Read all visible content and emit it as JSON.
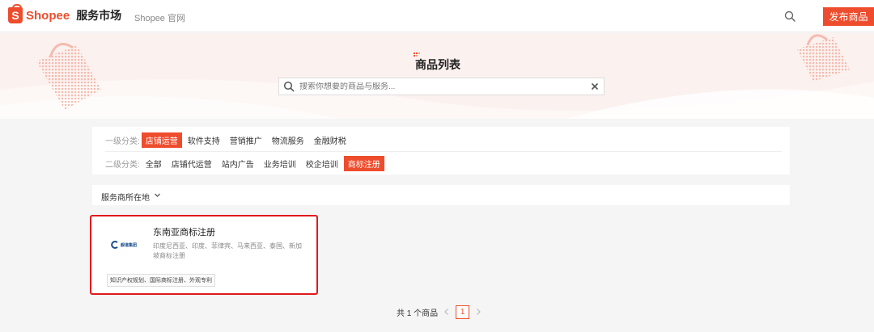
{
  "colors": {
    "brand": "#ee4d2d",
    "highlight_border": "#e0191c"
  },
  "header": {
    "logo_icon": "shopee-bag-icon",
    "logo_glyph": "S",
    "brand": "Shopee",
    "market": "服务市场",
    "official_link": "Shopee 官网",
    "search_icon": "search-icon",
    "publish_button": "发布商品"
  },
  "banner": {
    "title": "商品列表",
    "search_placeholder": "搜索你想要的商品与服务...",
    "search_icon": "search-icon",
    "clear_icon": "close-icon"
  },
  "categories": {
    "level1_label": "一级分类:",
    "level1_items": [
      "店铺运营",
      "软件支持",
      "营销推广",
      "物流服务",
      "金融财税"
    ],
    "level1_active": 0,
    "level2_label": "二级分类:",
    "level2_items": [
      "全部",
      "店铺代运营",
      "站内广告",
      "业务培训",
      "校企培训",
      "商标注册"
    ],
    "level2_active": 5
  },
  "location_filter": {
    "label": "服务商所在地",
    "icon": "chevron-down-icon"
  },
  "products": [
    {
      "logo_text": "舰道集团",
      "title": "东南亚商标注册",
      "description": "印度尼西亚、印度、菲律宾、马来西亚、泰国、新加坡商标注册",
      "tag": "知识产权规划、国际商标注册、外观专利"
    }
  ],
  "pagination": {
    "total_text": "共 1 个商品",
    "current_page": "1",
    "prev_icon": "chevron-left-icon",
    "next_icon": "chevron-right-icon"
  }
}
